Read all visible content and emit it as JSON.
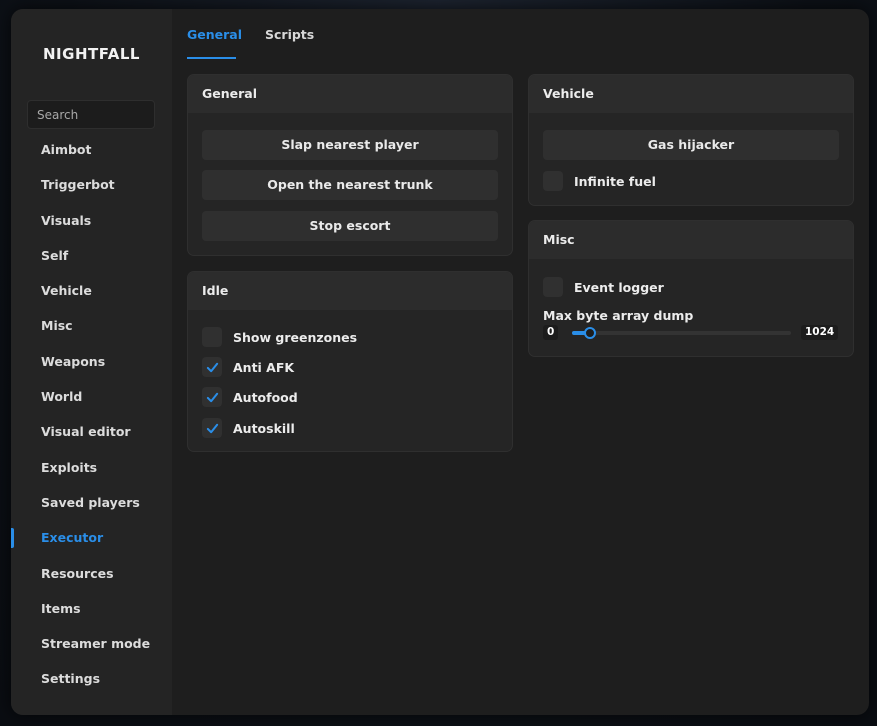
{
  "app": {
    "title": "NIGHTFALL"
  },
  "search": {
    "placeholder": "Search"
  },
  "sidebar": {
    "items": [
      {
        "label": "Aimbot"
      },
      {
        "label": "Triggerbot"
      },
      {
        "label": "Visuals"
      },
      {
        "label": "Self"
      },
      {
        "label": "Vehicle"
      },
      {
        "label": "Misc"
      },
      {
        "label": "Weapons"
      },
      {
        "label": "World"
      },
      {
        "label": "Visual editor"
      },
      {
        "label": "Exploits"
      },
      {
        "label": "Saved players"
      },
      {
        "label": "Executor",
        "active": true
      },
      {
        "label": "Resources"
      },
      {
        "label": "Items"
      },
      {
        "label": "Streamer mode"
      },
      {
        "label": "Settings"
      }
    ]
  },
  "tabs": [
    {
      "label": "General",
      "active": true
    },
    {
      "label": "Scripts"
    }
  ],
  "panels": {
    "general": {
      "title": "General",
      "buttons": [
        "Slap nearest player",
        "Open the nearest trunk",
        "Stop escort"
      ]
    },
    "idle": {
      "title": "Idle",
      "checks": [
        {
          "label": "Show greenzones",
          "checked": false
        },
        {
          "label": "Anti AFK",
          "checked": true
        },
        {
          "label": "Autofood",
          "checked": true
        },
        {
          "label": "Autoskill",
          "checked": true
        }
      ]
    },
    "vehicle": {
      "title": "Vehicle",
      "button": "Gas hijacker",
      "check": {
        "label": "Infinite fuel",
        "checked": false
      }
    },
    "misc": {
      "title": "Misc",
      "check": {
        "label": "Event logger",
        "checked": false
      },
      "slider": {
        "label": "Max byte array dump",
        "min": "0",
        "max": "1024",
        "value_fraction": 0.08
      }
    }
  },
  "colors": {
    "accent": "#2a8ee8",
    "background": "#1e1e1e",
    "sidebar": "#242424"
  }
}
